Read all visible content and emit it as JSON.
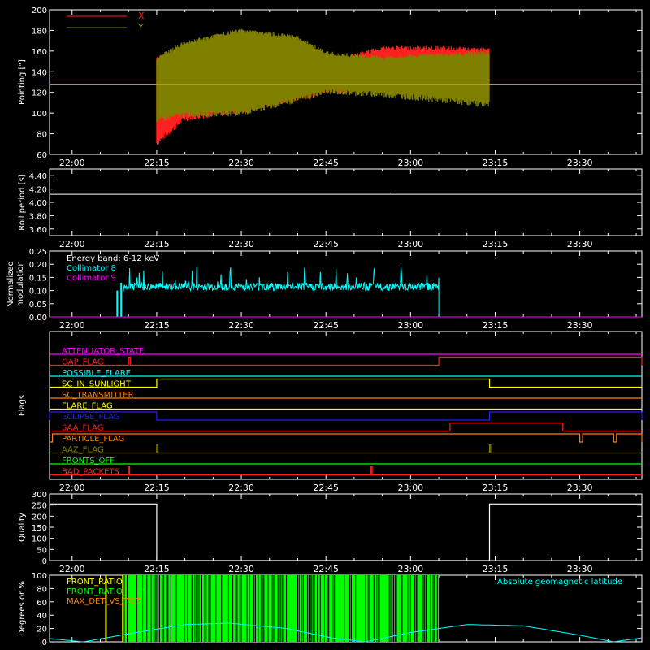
{
  "colors": {
    "background": "#000000",
    "axis": "#ffffff",
    "x_series": "#ff2020",
    "y_series": "#808000",
    "baseline": "#b8a000",
    "cyan": "#00ffff",
    "magenta": "#ff00ff",
    "green": "#00ff00",
    "yellow": "#ffff00",
    "orange": "#ff8000",
    "red": "#ff2020",
    "blue": "#2020ff"
  },
  "time_axis": {
    "min": "21:56",
    "max": "23:41",
    "ticks": [
      "22:00",
      "22:15",
      "22:30",
      "22:45",
      "23:00",
      "23:15",
      "23:30"
    ]
  },
  "chart_data": [
    {
      "id": "pointing",
      "type": "area",
      "ylabel": "Pointing [\"]",
      "ylim": [
        60,
        200
      ],
      "yticks": [
        60,
        80,
        100,
        120,
        140,
        160,
        180,
        200
      ],
      "legend": [
        "X",
        "Y"
      ],
      "legend_placement": "top-left",
      "series": [
        {
          "name": "X",
          "x": [
            "22:15",
            "22:20",
            "22:30",
            "22:40",
            "22:45",
            "22:55",
            "23:05",
            "23:14"
          ],
          "low": [
            68,
            92,
            100,
            112,
            118,
            122,
            122,
            120
          ],
          "high": [
            155,
            165,
            172,
            160,
            150,
            165,
            165,
            163
          ]
        },
        {
          "name": "Y",
          "x": [
            "22:15",
            "22:20",
            "22:30",
            "22:40",
            "22:45",
            "22:55",
            "23:05",
            "23:14"
          ],
          "low": [
            90,
            96,
            97,
            110,
            118,
            115,
            110,
            105
          ],
          "high": [
            155,
            170,
            182,
            175,
            160,
            155,
            158,
            160
          ]
        }
      ],
      "reference_line": 128
    },
    {
      "id": "roll",
      "type": "line",
      "ylabel": "Roll period [s]",
      "ylim": [
        3.5,
        4.5
      ],
      "yticks": [
        3.6,
        3.8,
        4.0,
        4.2,
        4.4
      ],
      "series": [
        {
          "x": [
            "22:00",
            "23:41"
          ],
          "values": [
            4.12,
            4.12
          ]
        }
      ]
    },
    {
      "id": "modulation",
      "type": "bar",
      "ylabel": "Normalized modulation",
      "ylim": [
        0,
        0.25
      ],
      "yticks": [
        0.0,
        0.05,
        0.1,
        0.15,
        0.2,
        0.25
      ],
      "legend": [
        "Energy band: 6-12 keV",
        "Collimator 8",
        "Collimator 9"
      ],
      "legend_placement": "top-left",
      "series": [
        {
          "name": "Collimator 8",
          "x_range": [
            "22:09",
            "23:05"
          ],
          "level": 0.115,
          "spread": 0.03
        },
        {
          "name": "Collimator 9",
          "values": [
            0.0
          ]
        }
      ],
      "spikes": [
        {
          "x": "22:08",
          "value": 0.1
        },
        {
          "x": "22:08.7",
          "value": 0.13
        }
      ]
    },
    {
      "id": "flags",
      "type": "line",
      "ylabel": "Flags",
      "rows": [
        {
          "label": "ATTENUATOR_STATE",
          "color": "magenta",
          "segments": []
        },
        {
          "label": "GAP_FLAG",
          "color": "red",
          "segments": [
            [
              "22:10",
              "22:10.3"
            ],
            [
              "23:05",
              "23:41"
            ]
          ]
        },
        {
          "label": "POSSIBLE_FLARE",
          "color": "cyan",
          "segments": []
        },
        {
          "label": "SC_IN_SUNLIGHT",
          "color": "yellow",
          "segments": [
            [
              "22:15",
              "23:14"
            ]
          ]
        },
        {
          "label": "SC_TRANSMITTER",
          "color": "orange",
          "segments": []
        },
        {
          "label": "FLARE_FLAG",
          "color": "yellow",
          "segments": []
        },
        {
          "label": "ECLIPSE_FLAG",
          "color": "blue",
          "segments": [
            [
              "21:56",
              "22:15"
            ],
            [
              "23:14",
              "23:41"
            ]
          ]
        },
        {
          "label": "SAA_FLAG",
          "color": "red",
          "segments": [
            [
              "23:07",
              "23:27"
            ]
          ]
        },
        {
          "label": "PARTICLE_FLAG",
          "color": "orange",
          "segments": [
            [
              "21:56.5",
              "23:30"
            ],
            [
              "23:30.5",
              "23:36"
            ],
            [
              "23:36.5",
              "23:41"
            ]
          ]
        },
        {
          "label": "AAZ_FLAG",
          "color": "olive",
          "segments": [
            [
              "22:15",
              "22:15.2"
            ],
            [
              "23:14",
              "23:14.2"
            ]
          ]
        },
        {
          "label": "FRONTS_OFF",
          "color": "green",
          "segments": []
        },
        {
          "label": "BAD_PACKETS",
          "color": "red",
          "segments": [
            [
              "22:10",
              "22:10.2"
            ],
            [
              "22:53",
              "22:53.2"
            ]
          ]
        }
      ]
    },
    {
      "id": "quality",
      "type": "line",
      "ylabel": "Quality",
      "ylim": [
        0,
        300
      ],
      "yticks": [
        0,
        50,
        100,
        150,
        200,
        250,
        300
      ],
      "series": [
        {
          "x": [
            "21:56",
            "22:15",
            "22:15",
            "23:14",
            "23:14",
            "23:41"
          ],
          "values": [
            255,
            255,
            0,
            0,
            255,
            255
          ]
        }
      ]
    },
    {
      "id": "latitude",
      "type": "bar",
      "ylabel": "Degrees or %",
      "ylim": [
        0,
        100
      ],
      "yticks": [
        0,
        20,
        40,
        60,
        80,
        100
      ],
      "legend": [
        "FRONT_RATIO",
        "FRONT_RATIO_1525",
        "MAX_DET_VS_TOT"
      ],
      "legend_placement": "top-left",
      "annotation": "Absolute geomagnetic latitude",
      "front_ratio_x_range": [
        "22:09",
        "23:05"
      ],
      "yellow_bars": [
        "22:06",
        "22:09"
      ],
      "latitude_curve": {
        "x": [
          "21:56",
          "22:02",
          "22:10",
          "22:20",
          "22:28",
          "22:38",
          "22:46",
          "22:52",
          "23:00",
          "23:10",
          "23:20",
          "23:30",
          "23:36",
          "23:41"
        ],
        "values": [
          5,
          0,
          12,
          26,
          28,
          20,
          6,
          0,
          14,
          26,
          24,
          10,
          0,
          6
        ]
      }
    }
  ]
}
